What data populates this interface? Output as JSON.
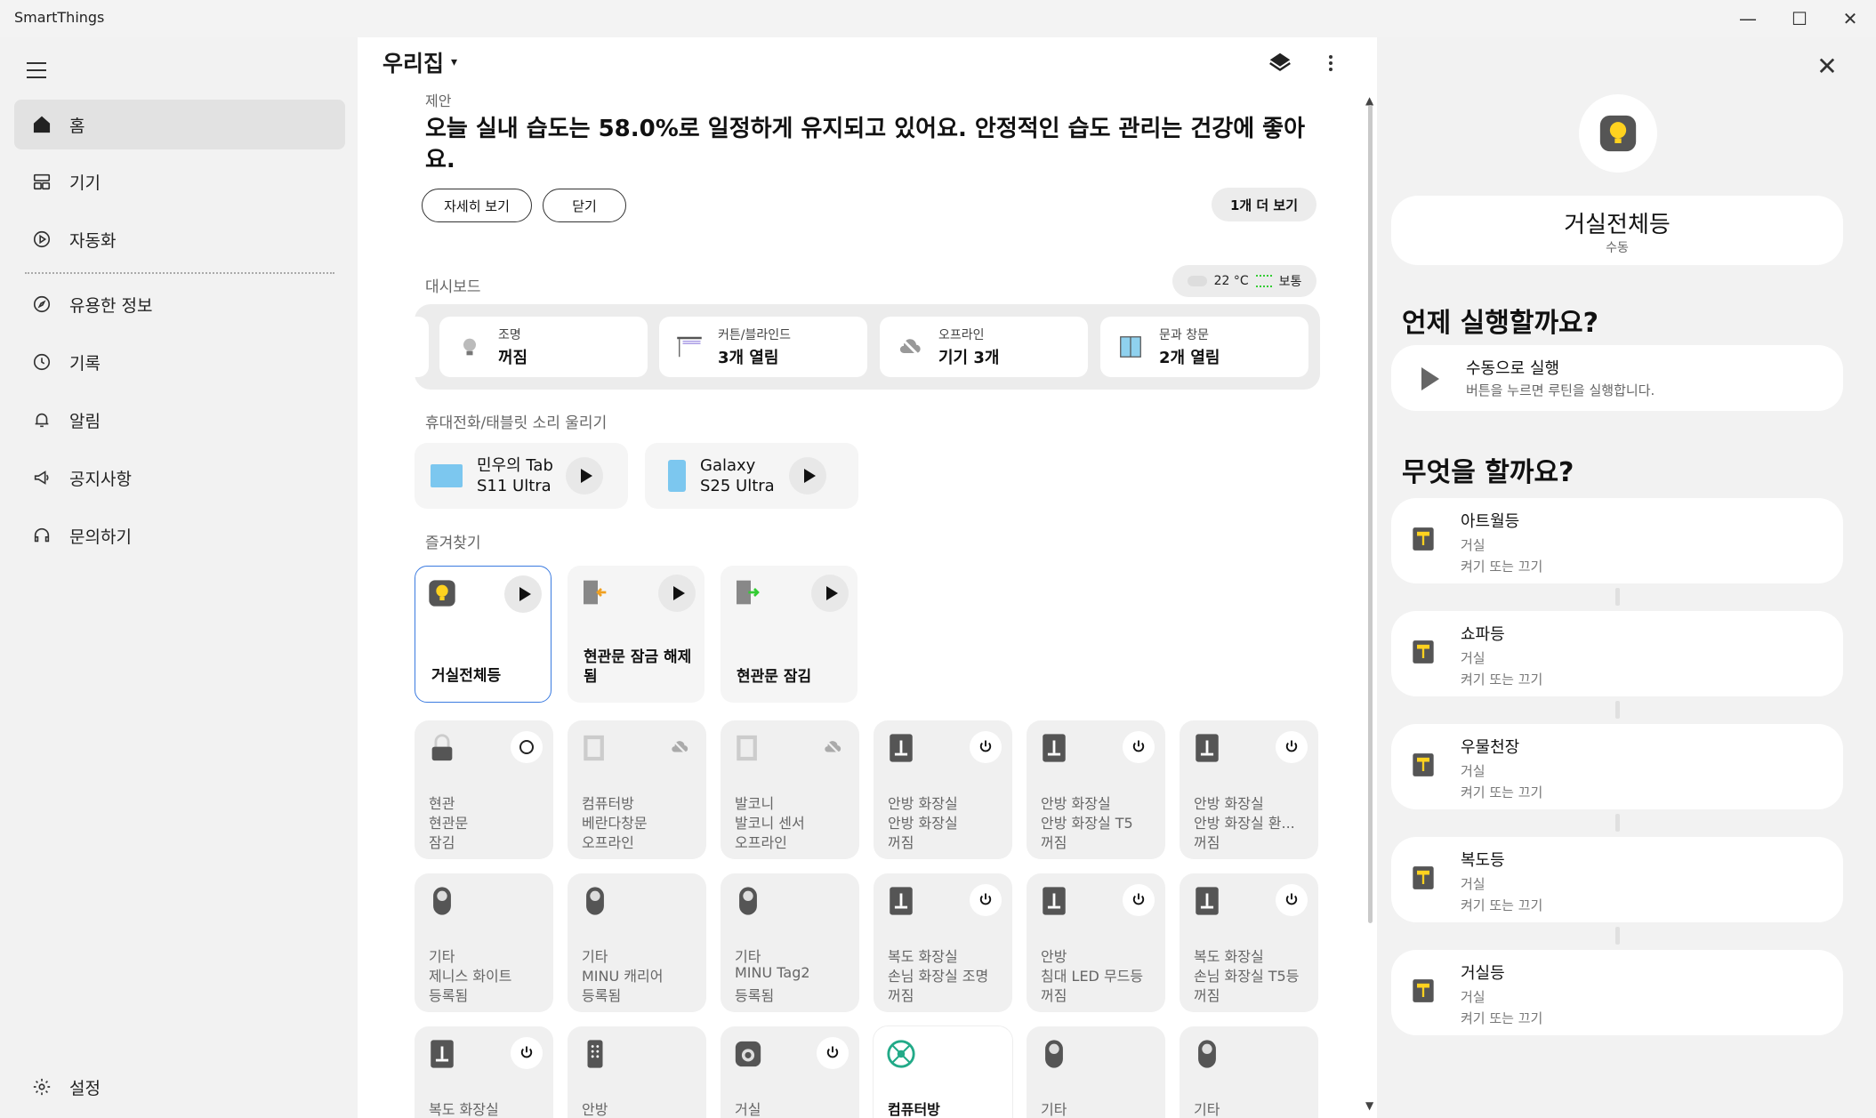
{
  "window": {
    "title": "SmartThings",
    "minimize": "—",
    "maximize": "☐",
    "close": "✕"
  },
  "sidebar": {
    "items": [
      {
        "label": "홈"
      },
      {
        "label": "기기"
      },
      {
        "label": "자동화"
      },
      {
        "label": "유용한 정보"
      },
      {
        "label": "기록"
      },
      {
        "label": "알림"
      },
      {
        "label": "공지사항"
      },
      {
        "label": "문의하기"
      }
    ],
    "settings": "설정"
  },
  "header": {
    "home_name": "우리집",
    "caret": "▾"
  },
  "suggestion": {
    "label": "제안",
    "text": "오늘 실내 습도는 58.0%로 일정하게 유지되고 있어요. 안정적인 습도 관리는 건강에 좋아요.",
    "details_btn": "자세히 보기",
    "close_btn": "닫기",
    "more_btn": "1개 더 보기"
  },
  "dashboard": {
    "label": "대시보드",
    "weather": {
      "temp": "22 °C",
      "air": "보통"
    },
    "cards": [
      {
        "label": "조명",
        "value": "꺼짐"
      },
      {
        "label": "커튼/블라인드",
        "value": "3개 열림"
      },
      {
        "label": "오프라인",
        "value": "기기 3개"
      },
      {
        "label": "문과 창문",
        "value": "2개 열림"
      }
    ]
  },
  "ring": {
    "label": "휴대전화/태블릿 소리 울리기",
    "devices": [
      {
        "name": "민우의 Tab S11 Ultra"
      },
      {
        "name": "Galaxy S25 Ultra"
      }
    ]
  },
  "favorites": {
    "label": "즐겨찾기",
    "items": [
      {
        "name": "거실전체등"
      },
      {
        "name": "현관문 잠금 해제됨"
      },
      {
        "name": "현관문 잠김"
      }
    ]
  },
  "devices": [
    {
      "l1": "현관",
      "l2": "현관문",
      "l3": "잠김"
    },
    {
      "l1": "컴퓨터방",
      "l2": "베란다창문",
      "l3": "오프라인"
    },
    {
      "l1": "발코니",
      "l2": "발코니 센서",
      "l3": "오프라인"
    },
    {
      "l1": "안방 화장실",
      "l2": "안방 화장실",
      "l3": "꺼짐"
    },
    {
      "l1": "안방 화장실",
      "l2": "안방 화장실 T5",
      "l3": "꺼짐"
    },
    {
      "l1": "안방 화장실",
      "l2": "안방 화장실 환...",
      "l3": "꺼짐"
    },
    {
      "l1": "기타",
      "l2": "제니스 화이트",
      "l3": "등록됨"
    },
    {
      "l1": "기타",
      "l2": "MINU 캐리어",
      "l3": "등록됨"
    },
    {
      "l1": "기타",
      "l2": "MINU Tag2",
      "l3": "등록됨"
    },
    {
      "l1": "복도 화장실",
      "l2": "손님 화장실 조명",
      "l3": "꺼짐"
    },
    {
      "l1": "안방",
      "l2": "침대 LED 무드등",
      "l3": "꺼짐"
    },
    {
      "l1": "복도 화장실",
      "l2": "손님 화장실 T5등",
      "l3": "꺼짐"
    },
    {
      "l1": "복도 화장실"
    },
    {
      "l1": "안방"
    },
    {
      "l1": "거실"
    },
    {
      "l1": "컴퓨터방"
    },
    {
      "l1": "기타"
    },
    {
      "l1": "기타"
    }
  ],
  "routine": {
    "name": "거실전체등",
    "mode": "수동",
    "when_title": "언제 실행할까요?",
    "manual_title": "수동으로 실행",
    "manual_sub": "버튼을 누르면 루틴을 실행합니다.",
    "what_title": "무엇을 할까요?",
    "actions": [
      {
        "name": "아트월등",
        "room": "거실",
        "action": "켜기 또는 끄기"
      },
      {
        "name": "쇼파등",
        "room": "거실",
        "action": "켜기 또는 끄기"
      },
      {
        "name": "우물천장",
        "room": "거실",
        "action": "켜기 또는 끄기"
      },
      {
        "name": "복도등",
        "room": "거실",
        "action": "켜기 또는 끄기"
      },
      {
        "name": "거실등",
        "room": "거실",
        "action": "켜기 또는 끄기"
      }
    ]
  },
  "colors": {
    "accent": "#3b7be0",
    "bulb_yellow": "#ffd21f",
    "icon_dark": "#555555"
  }
}
